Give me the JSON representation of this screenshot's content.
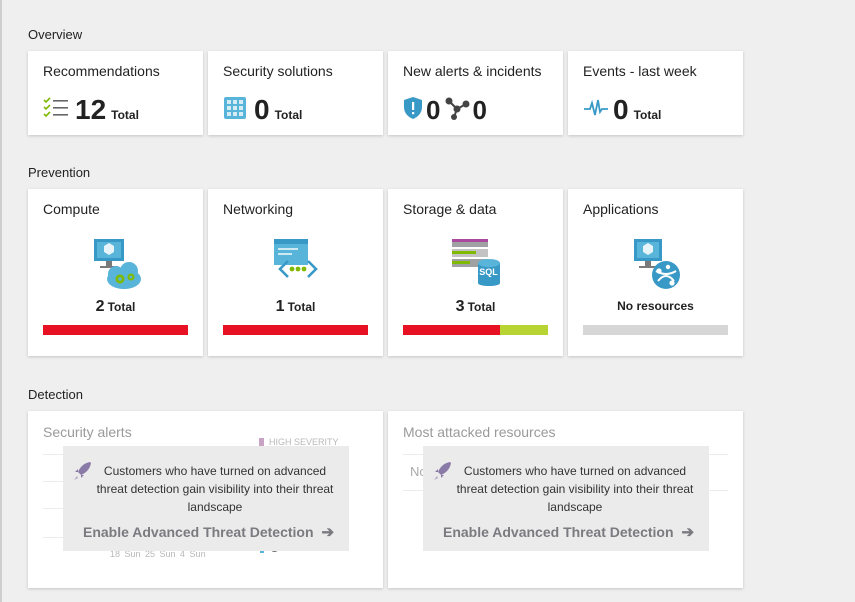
{
  "sections": {
    "overview": "Overview",
    "prevention": "Prevention",
    "detection": "Detection"
  },
  "overview": [
    {
      "title": "Recommendations",
      "value": "12",
      "unit": "Total",
      "icon": "checklist-icon"
    },
    {
      "title": "Security solutions",
      "value": "0",
      "unit": "Total",
      "icon": "solutions-grid-icon"
    },
    {
      "title": "New alerts & incidents",
      "alerts_value": "0",
      "incidents_value": "0",
      "icon": "shield-alert-icon"
    },
    {
      "title": "Events - last week",
      "value": "0",
      "unit": "Total",
      "icon": "pulse-icon"
    }
  ],
  "prevention": [
    {
      "title": "Compute",
      "count": "2",
      "unit": "Total",
      "icon": "compute-icon",
      "bar": [
        {
          "color": "#e81123",
          "fraction": 1.0
        }
      ]
    },
    {
      "title": "Networking",
      "count": "1",
      "unit": "Total",
      "icon": "networking-icon",
      "bar": [
        {
          "color": "#e81123",
          "fraction": 1.0
        }
      ]
    },
    {
      "title": "Storage & data",
      "count": "3",
      "unit": "Total",
      "icon": "storage-sql-icon",
      "bar": [
        {
          "color": "#e81123",
          "fraction": 0.67
        },
        {
          "color": "#b8d432",
          "fraction": 0.33
        }
      ]
    },
    {
      "title": "Applications",
      "status": "No resources",
      "icon": "applications-icon",
      "bar": [
        {
          "color": "#d6d6d6",
          "fraction": 1.0
        }
      ]
    }
  ],
  "detection": {
    "security_alerts": {
      "title": "Security alerts",
      "legend": "HIGH SEVERITY",
      "axis_labels": "18 Sun  25 Sun  4 Sun"
    },
    "most_attacked": {
      "title": "Most attacked resources",
      "partial_text": "No"
    },
    "overlay": {
      "message": "Customers who have turned on advanced threat detection gain visibility into their threat landscape",
      "cta": "Enable Advanced Threat Detection",
      "cta_arrow": "➔"
    }
  },
  "colors": {
    "red": "#e81123",
    "green": "#b8d432",
    "grey": "#d6d6d6",
    "azure_blue": "#3999c6"
  }
}
